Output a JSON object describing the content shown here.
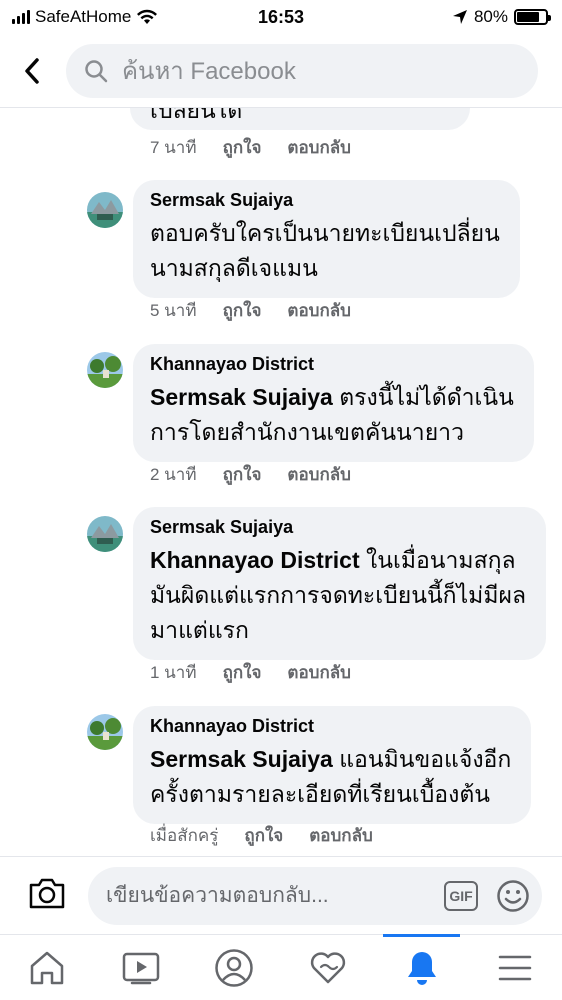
{
  "status_bar": {
    "carrier": "SafeAtHome",
    "time": "16:53",
    "battery": "80%",
    "battery_level": 0.8
  },
  "header": {
    "search_placeholder": "ค้นหา Facebook"
  },
  "partial_comment": {
    "text_fragment": "เปลี่ยนได้",
    "time": "7 นาที",
    "like_label": "ถูกใจ",
    "reply_label": "ตอบกลับ"
  },
  "comments": [
    {
      "author": "Sermsak Sujaiya",
      "mention": "",
      "lines": [
        "ตอบครับใครเป็นนายทะเบียนเปลี่ยน",
        "นามสกุลดีเจแมน"
      ],
      "time": "5 นาที",
      "like_label": "ถูกใจ",
      "reply_label": "ตอบกลับ"
    },
    {
      "author": "Khannayao District",
      "mention": "Sermsak Sujaiya",
      "lines": [
        "ตรงนี้ไม่ได้ดำเนิน",
        "การโดยสำนักงานเขตคันนายาว"
      ],
      "time": "2 นาที",
      "like_label": "ถูกใจ",
      "reply_label": "ตอบกลับ"
    },
    {
      "author": "Sermsak Sujaiya",
      "mention": "Khannayao District",
      "lines": [
        "ในเมื่อนามสกุล",
        "มันผิดแต่แรกการจดทะเบียนนี้ก็ไม่มีผล",
        "มาแต่แรก"
      ],
      "time": "1 นาที",
      "like_label": "ถูกใจ",
      "reply_label": "ตอบกลับ"
    },
    {
      "author": "Khannayao District",
      "mention": "Sermsak Sujaiya",
      "lines": [
        "แอนมินขอแจ้งอีก",
        "ครั้งตามรายละเอียดที่เรียนเบื้องต้น"
      ],
      "time": "เมื่อสักครู่",
      "like_label": "ถูกใจ",
      "reply_label": "ตอบกลับ"
    }
  ],
  "reply_bar": {
    "placeholder": "เขียนข้อความตอบกลับ...",
    "gif_label": "GIF"
  },
  "bottom_nav": {
    "items": [
      "home-icon",
      "watch-icon",
      "profile-icon",
      "dating-icon",
      "notifications-icon",
      "menu-icon"
    ],
    "active": "notifications-icon"
  },
  "colors": {
    "accent": "#1877f2",
    "bubble": "#f0f2f5",
    "secondary_text": "#65676b"
  }
}
